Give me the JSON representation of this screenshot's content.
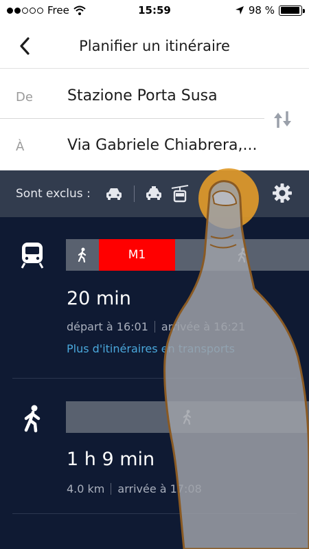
{
  "status_bar": {
    "carrier": "Free",
    "time": "15:59",
    "battery": "98 %",
    "battery_level": 0.98,
    "icons": [
      "signal-dots",
      "wifi-icon",
      "location-arrow-icon",
      "battery-icon"
    ]
  },
  "header": {
    "back_icon": "chevron-left-icon",
    "title": "Planifier un itinéraire"
  },
  "route": {
    "from_label": "De",
    "from_value": "Stazione Porta Susa",
    "to_label": "À",
    "to_value": "Via Gabriele Chiabrera,...",
    "swap_icon": "swap-arrows-icon"
  },
  "filters": {
    "excluded_label": "Sont exclus :",
    "icons": [
      "car-icon",
      "taxi-icon",
      "cable-car-icon",
      "gear-icon"
    ]
  },
  "results": [
    {
      "mode_icon": "metro-train-icon",
      "segments": [
        "walk",
        "M1",
        "walk"
      ],
      "line_label": "M1",
      "line_color": "#ff0000",
      "duration": "20 min",
      "departure": "départ à 16:01",
      "arrival": "arrivée à 16:21",
      "more_link": "Plus d'itinéraires en transports"
    },
    {
      "mode_icon": "walking-person-icon",
      "segments": [
        "walk"
      ],
      "duration": "1 h 9 min",
      "distance": "4.0 km",
      "arrival": "arrivée à 17:08"
    }
  ],
  "colors": {
    "background": "#0f1a33",
    "filter_bar": "#323c4e",
    "segment_grey": "#59616f",
    "link": "#4aa8dc",
    "tap_indicator": "#e09a2a"
  }
}
